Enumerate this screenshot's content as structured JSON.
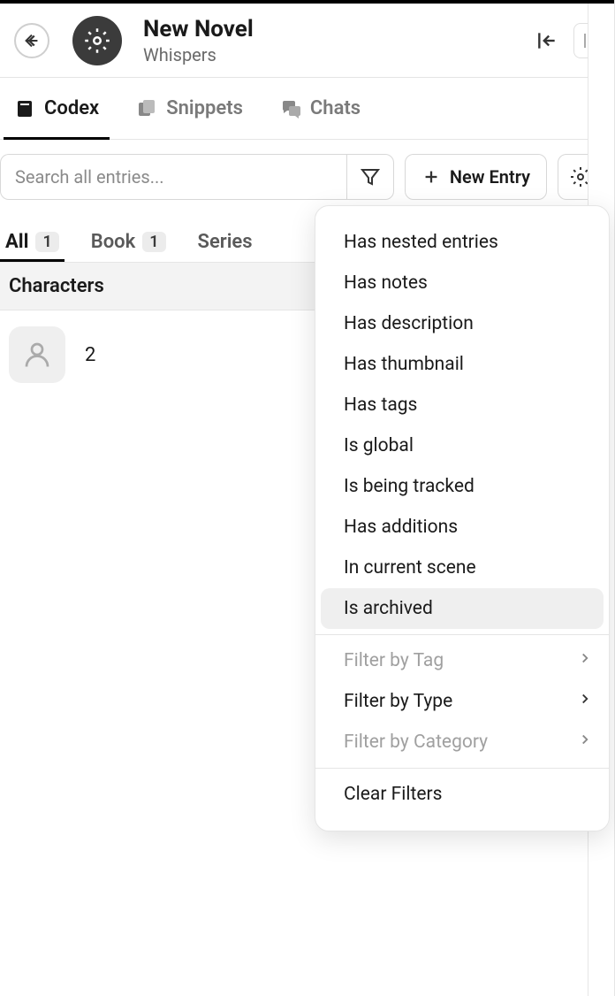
{
  "header": {
    "title": "New Novel",
    "subtitle": "Whispers"
  },
  "tabs": [
    {
      "label": "Codex",
      "active": true
    },
    {
      "label": "Snippets",
      "active": false
    },
    {
      "label": "Chats",
      "active": false
    }
  ],
  "toolbar": {
    "search_placeholder": "Search all entries...",
    "new_entry_label": "New Entry"
  },
  "filter_tabs": [
    {
      "label": "All",
      "count": "1",
      "active": true
    },
    {
      "label": "Book",
      "count": "1",
      "active": false
    },
    {
      "label": "Series",
      "active": false
    }
  ],
  "section": {
    "title": "Characters"
  },
  "entries": [
    {
      "name": "2"
    }
  ],
  "dropdown": {
    "filters": [
      {
        "label": "Has nested entries"
      },
      {
        "label": "Has notes"
      },
      {
        "label": "Has description"
      },
      {
        "label": "Has thumbnail"
      },
      {
        "label": "Has tags"
      },
      {
        "label": "Is global"
      },
      {
        "label": "Is being tracked"
      },
      {
        "label": "Has additions"
      },
      {
        "label": "In current scene"
      },
      {
        "label": "Is archived",
        "hovered": true
      }
    ],
    "sub_filters": [
      {
        "label": "Filter by Tag",
        "disabled": true,
        "chevron": true
      },
      {
        "label": "Filter by Type",
        "disabled": false,
        "chevron": true
      },
      {
        "label": "Filter by Category",
        "disabled": true,
        "chevron": true
      }
    ],
    "clear": {
      "label": "Clear Filters"
    }
  }
}
